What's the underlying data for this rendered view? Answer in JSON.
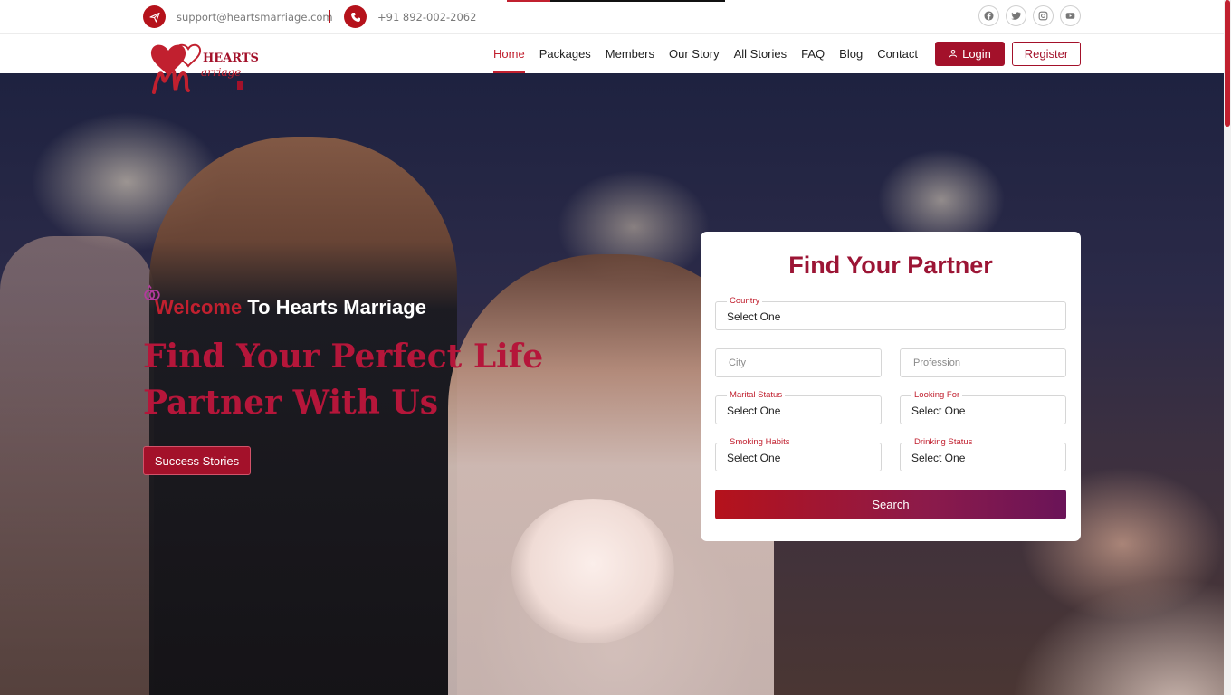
{
  "topbar": {
    "email": "support@heartsmarriage.com",
    "phone": "+91 892-002-2062",
    "socials": [
      "facebook-icon",
      "twitter-icon",
      "instagram-icon",
      "youtube-icon"
    ]
  },
  "brand": {
    "logo_text": "HEARTS",
    "logo_script": "Marriage"
  },
  "nav": {
    "items": [
      "Home",
      "Packages",
      "Members",
      "Our Story",
      "All Stories",
      "FAQ",
      "Blog",
      "Contact"
    ],
    "active": "Home",
    "login_label": "Login",
    "register_label": "Register"
  },
  "hero": {
    "welcome_part1": "Welcome",
    "welcome_part2": " To Hearts Marriage",
    "headline": "Find Your Perfect Life Partner With Us",
    "cta_label": "Success Stories"
  },
  "search": {
    "title": "Find Your Partner",
    "country": {
      "label": "Country",
      "value": "Select One"
    },
    "city": {
      "placeholder": "City"
    },
    "profession": {
      "placeholder": "Profession"
    },
    "marital_status": {
      "label": "Marital Status",
      "value": "Select One"
    },
    "looking_for": {
      "label": "Looking For",
      "value": "Select One"
    },
    "smoking_habits": {
      "label": "Smoking Habits",
      "value": "Select One"
    },
    "drinking_status": {
      "label": "Drinking Status",
      "value": "Select One"
    },
    "button_label": "Search"
  },
  "colors": {
    "brand_red": "#b5121b",
    "brand_maroon": "#a3112a",
    "title_color": "#9c1535",
    "gradient_end": "#6a1458"
  }
}
